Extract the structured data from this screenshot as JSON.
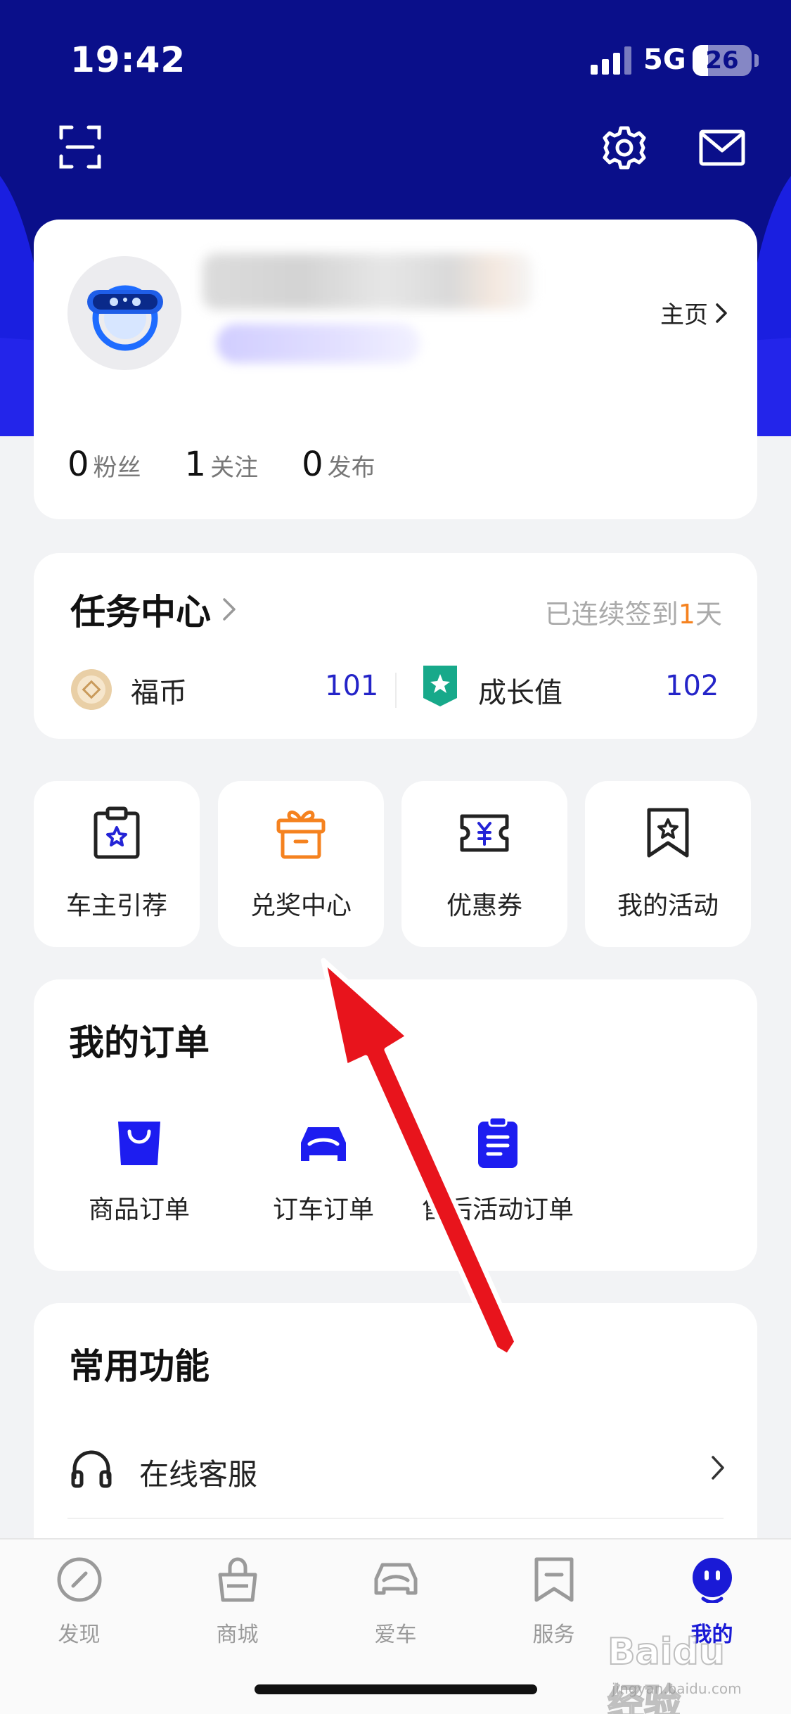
{
  "status_bar": {
    "time": "19:42",
    "network": "5G",
    "battery": "26",
    "battery_level": 0.26
  },
  "colors": {
    "hero": "#0a0f8a",
    "accent": "#1a1ad6",
    "value_blue": "#2424c8",
    "checkin_orange": "#f5821f",
    "tile_orange": "#f5821f",
    "arrow_red": "#e8141c"
  },
  "header_icons": [
    "scan-icon",
    "gear-icon",
    "mail-icon"
  ],
  "profile": {
    "homepage_label": "主页",
    "stats": [
      {
        "value": "0",
        "label": "粉丝"
      },
      {
        "value": "1",
        "label": "关注"
      },
      {
        "value": "0",
        "label": "发布"
      }
    ]
  },
  "task_center": {
    "title": "任务中心",
    "checkin_prefix": "已连续签到",
    "checkin_days": "1",
    "checkin_suffix": "天",
    "coin_label": "福币",
    "coin_value": "101",
    "growth_label": "成长值",
    "growth_value": "102"
  },
  "quick_tiles": [
    {
      "label": "车主引荐",
      "icon": "clipboard-star-icon"
    },
    {
      "label": "兑奖中心",
      "icon": "gift-box-icon"
    },
    {
      "label": "优惠券",
      "icon": "coupon-icon"
    },
    {
      "label": "我的活动",
      "icon": "bookmark-star-icon"
    }
  ],
  "orders": {
    "title": "我的订单",
    "items": [
      {
        "label": "商品订单",
        "icon": "shopping-bag-icon"
      },
      {
        "label": "订车订单",
        "icon": "car-icon"
      },
      {
        "label": "售后活动订单",
        "icon": "document-list-icon"
      }
    ]
  },
  "common": {
    "title": "常用功能",
    "items": [
      {
        "label": "在线客服",
        "icon": "headset-icon"
      }
    ]
  },
  "tabs": [
    {
      "label": "发现",
      "icon": "compass-icon",
      "active": false
    },
    {
      "label": "商城",
      "icon": "bag-icon",
      "active": false
    },
    {
      "label": "爱车",
      "icon": "car-outline-icon",
      "active": false
    },
    {
      "label": "服务",
      "icon": "bookmark-icon",
      "active": false
    },
    {
      "label": "我的",
      "icon": "face-icon",
      "active": true
    }
  ],
  "watermark": {
    "main": "Baidu经验",
    "sub": "jingyan.baidu.com"
  }
}
